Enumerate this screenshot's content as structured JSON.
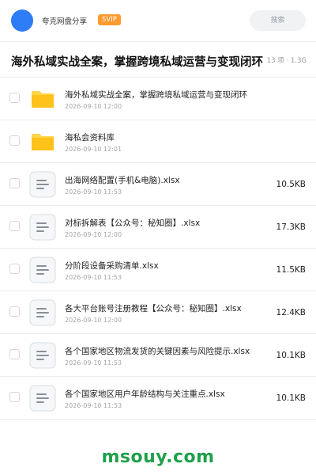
{
  "header": {
    "owner_name": "夸克网盘分享",
    "badge": "SVIP",
    "search_label": "搜索"
  },
  "folder": {
    "title": "海外私域实战全案，掌握跨境私域运营与变现闭环",
    "meta": "13 项 · 1.3G"
  },
  "files": [
    {
      "type": "folder",
      "name": "海外私域实战全案，掌握跨境私域运营与变现闭环",
      "date": "2026-09-10 12:00",
      "size": ""
    },
    {
      "type": "folder",
      "name": "海私会资料库",
      "date": "2026-09-10 12:01",
      "size": ""
    },
    {
      "type": "file",
      "name": "出海网络配置(手机&电脑).xlsx",
      "date": "2026-09-10 11:53",
      "size": "10.5KB"
    },
    {
      "type": "file",
      "name": "对标拆解表【公众号：秘知圈】.xlsx",
      "date": "2026-09-10 12:00",
      "size": "17.3KB"
    },
    {
      "type": "file",
      "name": "分阶段设备采购清单.xlsx",
      "date": "2026-09-10 11:53",
      "size": "11.5KB"
    },
    {
      "type": "file",
      "name": "各大平台账号注册教程【公众号：秘知圈】.xlsx",
      "date": "2026-09-10 12:00",
      "size": "12.4KB"
    },
    {
      "type": "file",
      "name": "各个国家地区物流发货的关键因素与风险提示.xlsx",
      "date": "2026-09-10 11:53",
      "size": "10.1KB"
    },
    {
      "type": "file",
      "name": "各个国家地区用户年龄结构与关注重点.xlsx",
      "date": "2026-09-10 11:53",
      "size": "10.1KB"
    }
  ],
  "watermark": "msouy.com",
  "colors": {
    "avatar": "#2e7cf6",
    "badge": "#ff9a2e",
    "folder": "#ffc21a",
    "watermark": "#1fa04a"
  }
}
